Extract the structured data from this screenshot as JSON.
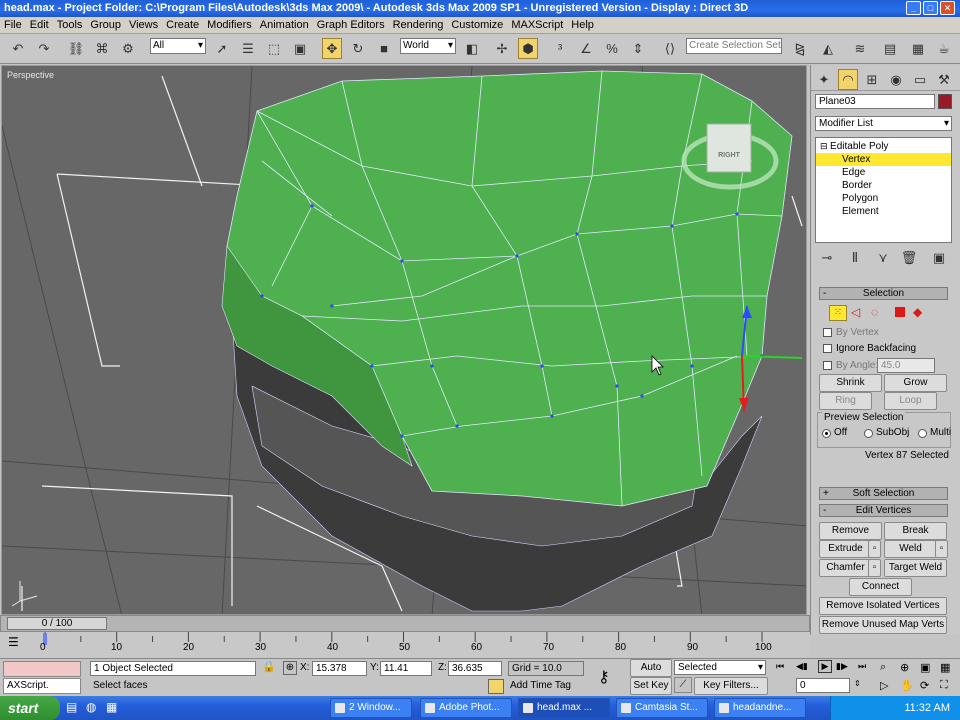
{
  "window": {
    "title": "head.max    -    Project Folder: C:\\Program Files\\Autodesk\\3ds Max 2009\\    -    Autodesk 3ds Max  2009 SP1    -    Unregistered Version    -    Display : Direct 3D"
  },
  "menu": [
    "File",
    "Edit",
    "Tools",
    "Group",
    "Views",
    "Create",
    "Modifiers",
    "Animation",
    "Graph Editors",
    "Rendering",
    "Customize",
    "MAXScript",
    "Help"
  ],
  "toolbar": {
    "filter": "All",
    "coord_system": "World",
    "selection_set_placeholder": "Create Selection Set"
  },
  "viewport": {
    "label": "Perspective",
    "viewcube_face": "RIGHT"
  },
  "command_panel": {
    "object_name": "Plane03",
    "modifier_list": "Modifier List",
    "stack": [
      {
        "label": "Editable Poly",
        "selected": false
      },
      {
        "label": "Vertex",
        "selected": true
      },
      {
        "label": "Edge",
        "selected": false
      },
      {
        "label": "Border",
        "selected": false
      },
      {
        "label": "Polygon",
        "selected": false
      },
      {
        "label": "Element",
        "selected": false
      }
    ],
    "selection": {
      "header": "Selection",
      "by_vertex": "By Vertex",
      "ignore_backfacing": "Ignore Backfacing",
      "by_angle": "By Angle:",
      "angle_value": "45.0",
      "shrink": "Shrink",
      "grow": "Grow",
      "ring": "Ring",
      "loop": "Loop",
      "preview_header": "Preview Selection",
      "preview_off": "Off",
      "preview_subobj": "SubObj",
      "preview_multi": "Multi",
      "status": "Vertex 87 Selected"
    },
    "soft_selection": "Soft Selection",
    "edit_vertices": {
      "header": "Edit Vertices",
      "remove": "Remove",
      "break": "Break",
      "extrude": "Extrude",
      "weld": "Weld",
      "chamfer": "Chamfer",
      "target_weld": "Target Weld",
      "connect": "Connect",
      "remove_isolated": "Remove Isolated Vertices",
      "remove_unused": "Remove Unused Map Verts"
    }
  },
  "timeline": {
    "slider_label": "0 / 100",
    "ticks": [
      "0",
      "10",
      "20",
      "30",
      "40",
      "50",
      "60",
      "70",
      "80",
      "90",
      "100"
    ]
  },
  "status": {
    "selected": "1 Object Selected",
    "prompt": "Select faces",
    "maxscript": "AXScript.",
    "x_label": "X:",
    "x": "15.378",
    "y_label": "Y:",
    "y": "11.41",
    "z_label": "Z:",
    "z": "36.635",
    "grid": "Grid = 10.0",
    "add_time_tag": "Add Time Tag",
    "auto_key": "Auto Key",
    "set_key": "Set Key",
    "key_mode": "Selected",
    "key_filters": "Key Filters...",
    "frame": "0"
  },
  "taskbar": {
    "start": "start",
    "tasks": [
      "2 Window...",
      "Adobe Phot...",
      "head.max ...",
      "Camtasia St...",
      "headandne..."
    ],
    "clock": "11:32 AM"
  },
  "colors": {
    "mesh_green": "#4fb04f",
    "viewport_bg": "#676767",
    "selection_yellow": "#ffe930",
    "object_color": "#9a1a2a"
  }
}
